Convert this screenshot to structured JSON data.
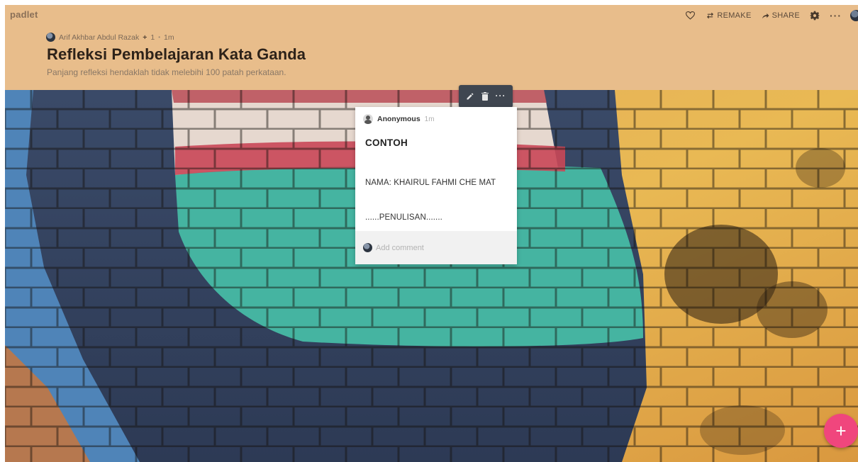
{
  "app": {
    "logo": "padlet"
  },
  "toolbar": {
    "heart_icon": "heart-icon",
    "remake_label": "REMAKE",
    "share_label": "SHARE",
    "more_label": "···"
  },
  "board": {
    "author": "Arif Akhbar Abdul Razak",
    "plus": "+",
    "count": "1",
    "separator": "•",
    "time": "1m",
    "title": "Refleksi Pembelajaran Kata Ganda",
    "description": "Panjang refleksi hendaklah tidak melebihi 100 patah perkataan."
  },
  "post": {
    "author": "Anonymous",
    "time": "1m",
    "title": "CONTOH",
    "lines": [
      "NAMA: KHAIRUL FAHMI CHE MAT",
      "......PENULISAN......."
    ],
    "toolbar_more": "···",
    "comment_placeholder": "Add comment"
  },
  "fab": {
    "label": "+"
  },
  "colors": {
    "header_bg": "#e8bd8b",
    "fab": "#f0467d",
    "toolbar": "#3f4650"
  }
}
